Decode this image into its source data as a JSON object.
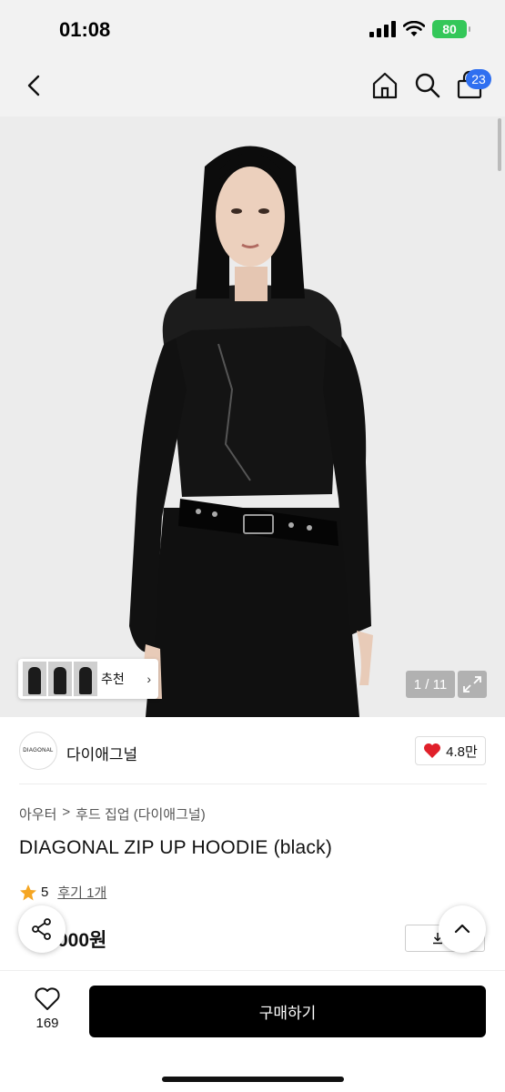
{
  "status_bar": {
    "time": "01:08",
    "battery": "80"
  },
  "nav": {
    "cart_badge": "23"
  },
  "gallery": {
    "recommend_label": "추천",
    "page_counter": "1 / 11"
  },
  "brand": {
    "logo_text": "DIAGONAL",
    "name": "다이애그널",
    "likes": "4.8만"
  },
  "product": {
    "breadcrumb": [
      "아우터",
      ">",
      "후드 집업 (다이애그널)"
    ],
    "title": "DIAGONAL ZIP UP HOODIE (black)",
    "rating": "5",
    "review_link": "후기 1개",
    "price": "000원",
    "coupon_label": "쿠"
  },
  "bottom_bar": {
    "wish_count": "169",
    "buy_label": "구매하기"
  },
  "colors": {
    "accent_blue": "#2f6ff0",
    "heart_red": "#e0202a",
    "star_orange": "#f5a623",
    "battery_green": "#34c759"
  }
}
